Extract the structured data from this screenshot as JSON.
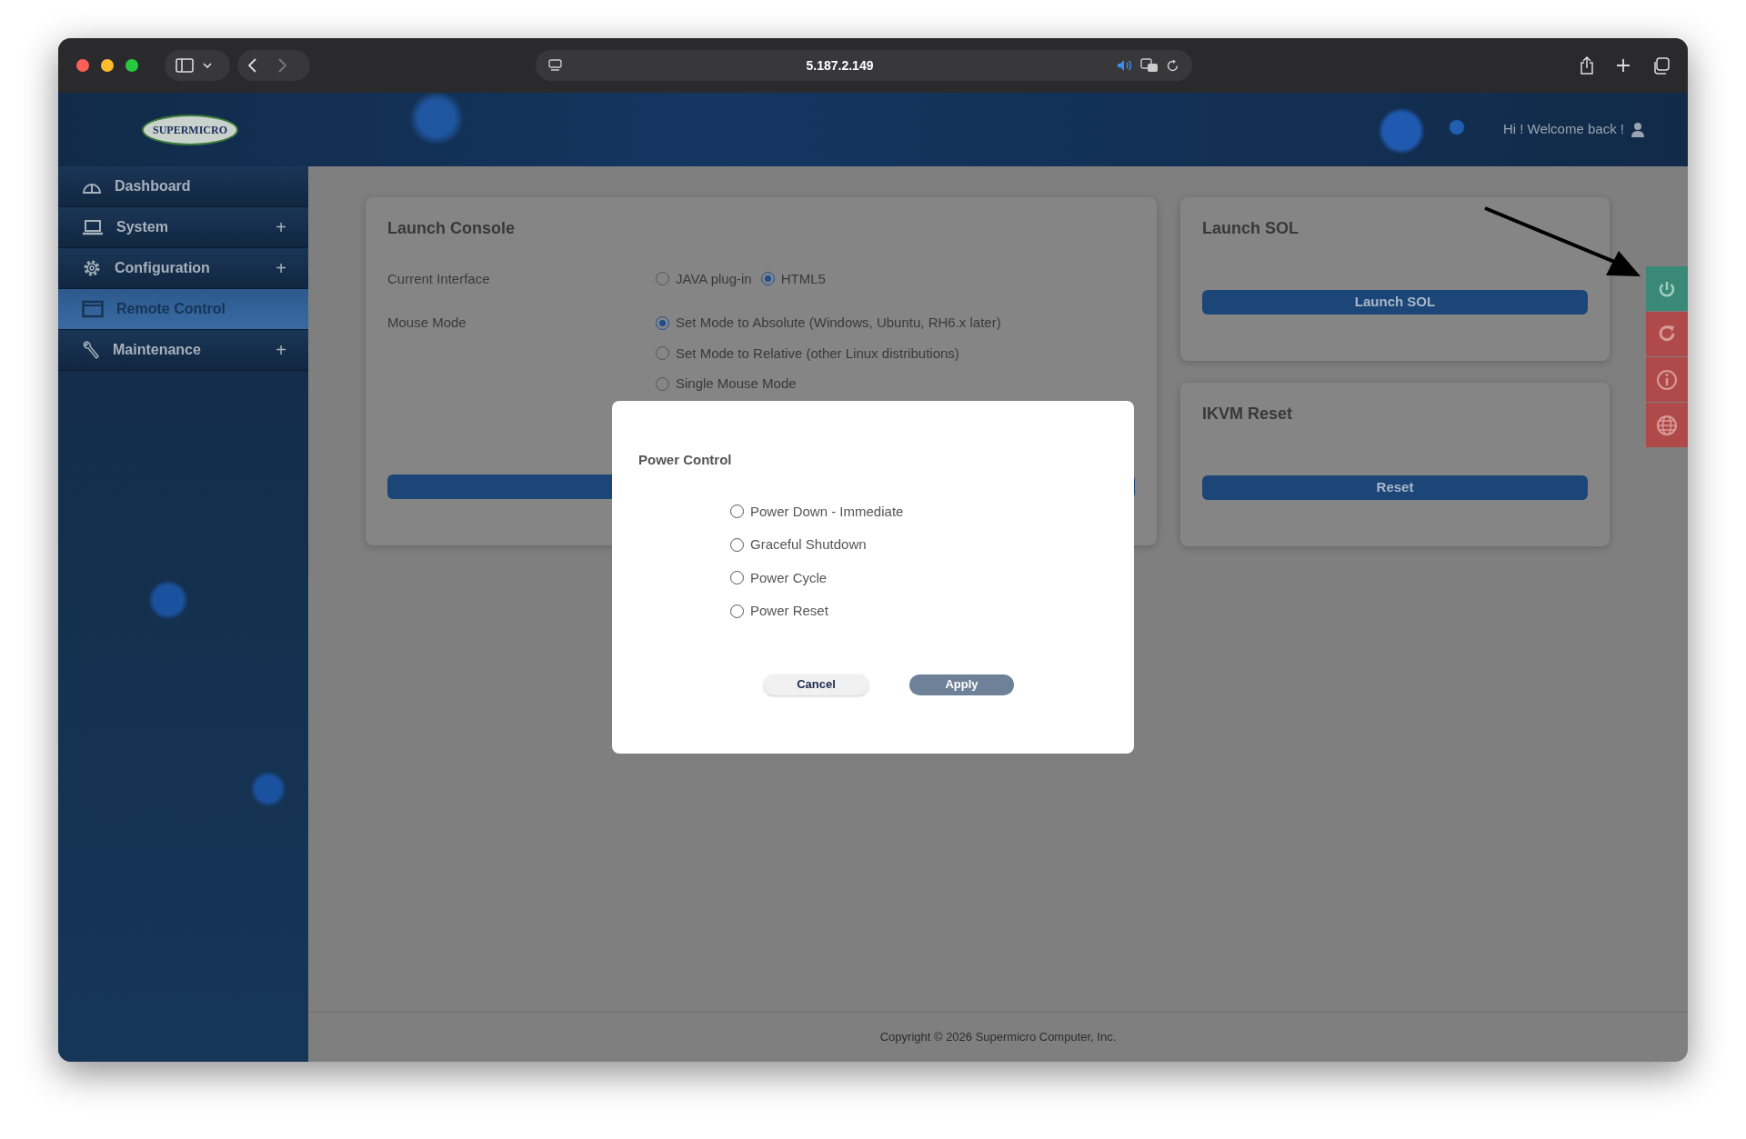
{
  "browser": {
    "address": "5.187.2.149"
  },
  "header": {
    "logo": "SUPERMICRO",
    "greeting": "Hi ! Welcome back !"
  },
  "sidebar": {
    "items": [
      {
        "label": "Dashboard",
        "selected": false
      },
      {
        "label": "System",
        "expander": "+",
        "selected": false
      },
      {
        "label": "Configuration",
        "expander": "+",
        "selected": false
      },
      {
        "label": "Remote Control",
        "selected": true
      },
      {
        "label": "Maintenance",
        "expander": "+",
        "selected": false
      }
    ]
  },
  "launch_console": {
    "title": "Launch Console",
    "fields": [
      {
        "label": "Current Interface",
        "kind": "inline",
        "options": [
          {
            "label": "JAVA plug-in",
            "selected": false
          },
          {
            "label": "HTML5",
            "selected": true
          }
        ]
      },
      {
        "label": "Mouse Mode",
        "kind": "stacked",
        "options": [
          {
            "label": "Set Mode to Absolute (Windows, Ubuntu, RH6.x later)",
            "selected": true
          },
          {
            "label": "Set Mode to Relative (other Linux distributions)",
            "selected": false
          },
          {
            "label": "Single Mouse Mode",
            "selected": false
          }
        ]
      }
    ]
  },
  "launch_sol": {
    "title": "Launch SOL",
    "button": "Launch SOL"
  },
  "ikvm_reset": {
    "title": "IKVM Reset",
    "button": "Reset"
  },
  "quick_actions": [
    {
      "color": "#3a8878"
    },
    {
      "color": "#b04a4a"
    },
    {
      "color": "#b04a4a"
    },
    {
      "color": "#b04a4a"
    }
  ],
  "footer": {
    "copyright": "Copyright © 2026 Supermicro Computer, Inc."
  },
  "dialog": {
    "title": "Power Control",
    "options": [
      {
        "label": "Power Down - Immediate",
        "selected": false
      },
      {
        "label": "Graceful Shutdown",
        "selected": false
      },
      {
        "label": "Power Cycle",
        "selected": false
      },
      {
        "label": "Power Reset",
        "selected": false
      }
    ],
    "buttons": [
      {
        "label": "Cancel",
        "kind": "secondary"
      },
      {
        "label": "Apply",
        "kind": "primary"
      }
    ]
  }
}
